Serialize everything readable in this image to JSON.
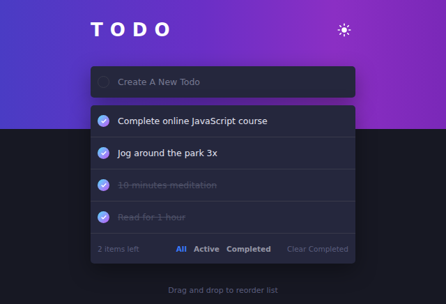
{
  "app": {
    "title": "TODO"
  },
  "new_todo": {
    "placeholder": "Create A New Todo",
    "checked": false
  },
  "todos": [
    {
      "text": "Complete online JavaScript course",
      "checked": true,
      "completed": false
    },
    {
      "text": "Jog around the park 3x",
      "checked": true,
      "completed": false
    },
    {
      "text": "10 minutes meditation",
      "checked": true,
      "completed": true
    },
    {
      "text": "Read for 1 hour",
      "checked": true,
      "completed": true
    }
  ],
  "footer": {
    "items_left": "2 items left",
    "filters": [
      {
        "label": "All",
        "selected": true
      },
      {
        "label": "Active",
        "selected": false
      },
      {
        "label": "Completed",
        "selected": false
      }
    ],
    "clear": "Clear Completed"
  },
  "hint": "Drag and drop to reorder list"
}
